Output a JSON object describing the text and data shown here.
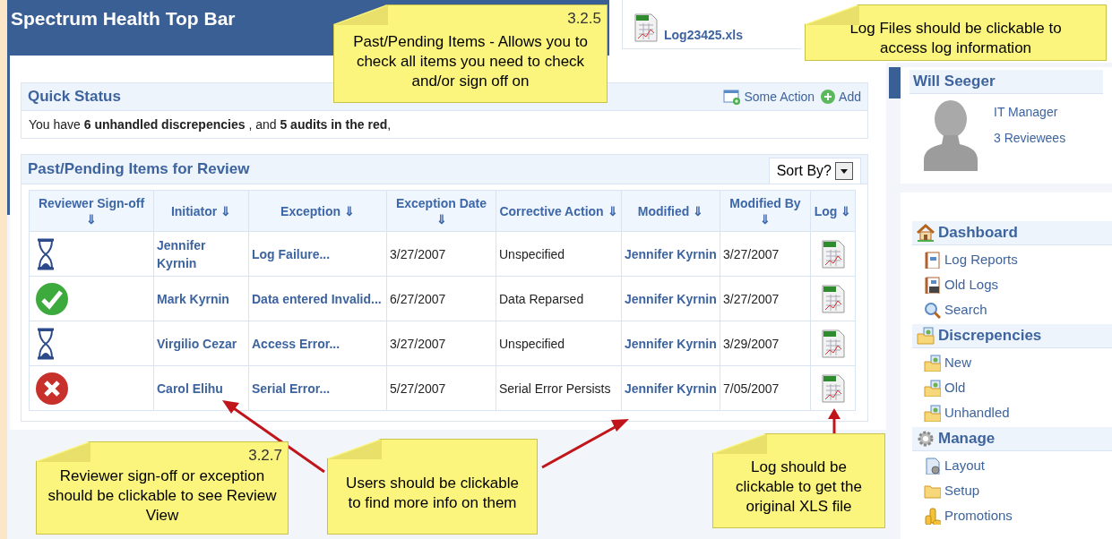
{
  "header": {
    "title": "Spectrum Health Top Bar"
  },
  "log_file": {
    "name": "Log23425.xls"
  },
  "quick_status": {
    "title": "Quick Status",
    "actions": [
      {
        "label": "Some Action",
        "kind": "window"
      },
      {
        "label": "Add",
        "kind": "add"
      }
    ],
    "message": "You have **6 unhandled discrepencies** , and **5 audits in the red**,"
  },
  "review": {
    "title": "Past/Pending Items for Review",
    "sort": {
      "label": "Sort By?"
    },
    "columns": [
      "Reviewer Sign-off ⇓",
      "Initiator ⇓",
      "Exception ⇓",
      "Exception Date ⇓",
      "Corrective Action ⇓",
      "Modified ⇓",
      "Modified By ⇓",
      "Log ⇓"
    ],
    "rows": [
      {
        "kind": "pending",
        "initiator": "Jennifer Kyrnin",
        "exception": "Log Failure...",
        "exception_date": "3/27/2007",
        "corrective_action": "Unspecified",
        "modified": "Jennifer Kyrnin",
        "modified_by": "3/27/2007"
      },
      {
        "kind": "approved",
        "initiator": "Mark Kyrnin",
        "exception": "Data entered Invalid...",
        "exception_date": "6/27/2007",
        "corrective_action": "Data Reparsed",
        "modified": "Jennifer Kyrnin",
        "modified_by": "3/27/2007"
      },
      {
        "kind": "pending",
        "initiator": "Virgilio Cezar",
        "exception": "Access Error...",
        "exception_date": "3/27/2007",
        "corrective_action": "Unspecified",
        "modified": "Jennifer Kyrnin",
        "modified_by": "3/29/2007"
      },
      {
        "kind": "rejected",
        "initiator": "Carol Elihu",
        "exception": "Serial Error...",
        "exception_date": "5/27/2007",
        "corrective_action": "Serial Error Persists",
        "modified": "Jennifer Kyrnin",
        "modified_by": "7/05/2007"
      }
    ]
  },
  "user": {
    "name": "Will Seeger",
    "role": "IT Manager",
    "reviewees": "3 Reviewees"
  },
  "nav": [
    {
      "label": "Dashboard",
      "items": [
        "Log Reports",
        "Old Logs",
        "Search"
      ]
    },
    {
      "label": "Discrepencies",
      "items": [
        "New",
        "Old",
        "Unhandled"
      ]
    },
    {
      "label": "Manage",
      "items": [
        "Layout",
        "Setup",
        "Promotions"
      ]
    }
  ],
  "callouts": [
    {
      "number": "3.2.5",
      "text": "Past/Pending Items - Allows you to check all items you need to check and/or sign off on"
    },
    {
      "text": "Log Files should be clickable to access log information"
    },
    {
      "number": "3.2.7",
      "text": "Reviewer sign-off or exception should be clickable to see Review View"
    },
    {
      "text": "Users should be clickable to find more info on them"
    },
    {
      "text": "Log should be clickable to get the original XLS file"
    }
  ]
}
